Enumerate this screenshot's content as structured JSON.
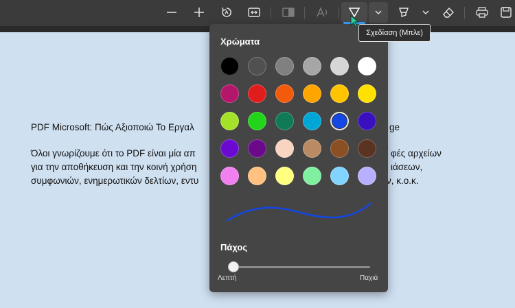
{
  "toolbar": {
    "icons": [
      "minus-icon",
      "plus-icon",
      "rotate-icon",
      "fit-width-icon",
      "page-view-icon",
      "read-aloud-icon",
      "draw-icon",
      "chevron-down-icon",
      "highlight-icon",
      "chevron-down-icon",
      "eraser-icon",
      "print-icon",
      "save-icon"
    ]
  },
  "document": {
    "line1": "PDF Microsoft: Πώς Αξιοποιώ Το Εργαλ",
    "line1_end": "ge",
    "line2": "Όλοι γνωρίζουμε ότι το PDF είναι μία απ",
    "line2_end": "φές αρχείων",
    "line3": "για την αποθήκευση και την κοινή χρήση",
    "line3_end": "ιάσεων,",
    "line4": "συμφωνιών, ενημερωτικών δελτίων, εντυ",
    "line4_end": "ν, κ.ο.κ."
  },
  "popup": {
    "colors_title": "Χρώματα",
    "colors": [
      "#000000",
      "#505050",
      "#808080",
      "#a6a6a6",
      "#d6d6d6",
      "#ffffff",
      "#b3166b",
      "#e01c1c",
      "#f25a0c",
      "#ffa500",
      "#ffc400",
      "#ffe100",
      "#a4e22a",
      "#22d41a",
      "#0f7a55",
      "#00a6d6",
      "#1347e6",
      "#3a0fbf",
      "#6a0ad1",
      "#6a0a8a",
      "#f8d4c1",
      "#b98a63",
      "#8a4f22",
      "#5a3322",
      "#f080f0",
      "#ffc080",
      "#ffff80",
      "#80f0a0",
      "#80d4ff",
      "#b8b0ff"
    ],
    "selected_color": "#1347e6",
    "thickness_title": "Πάχος",
    "thickness_min_label": "Λεπτή",
    "thickness_max_label": "Παχιά",
    "thickness_value": 0.0
  },
  "tooltip": {
    "text": "Σχεδίαση (Μπλε)"
  }
}
